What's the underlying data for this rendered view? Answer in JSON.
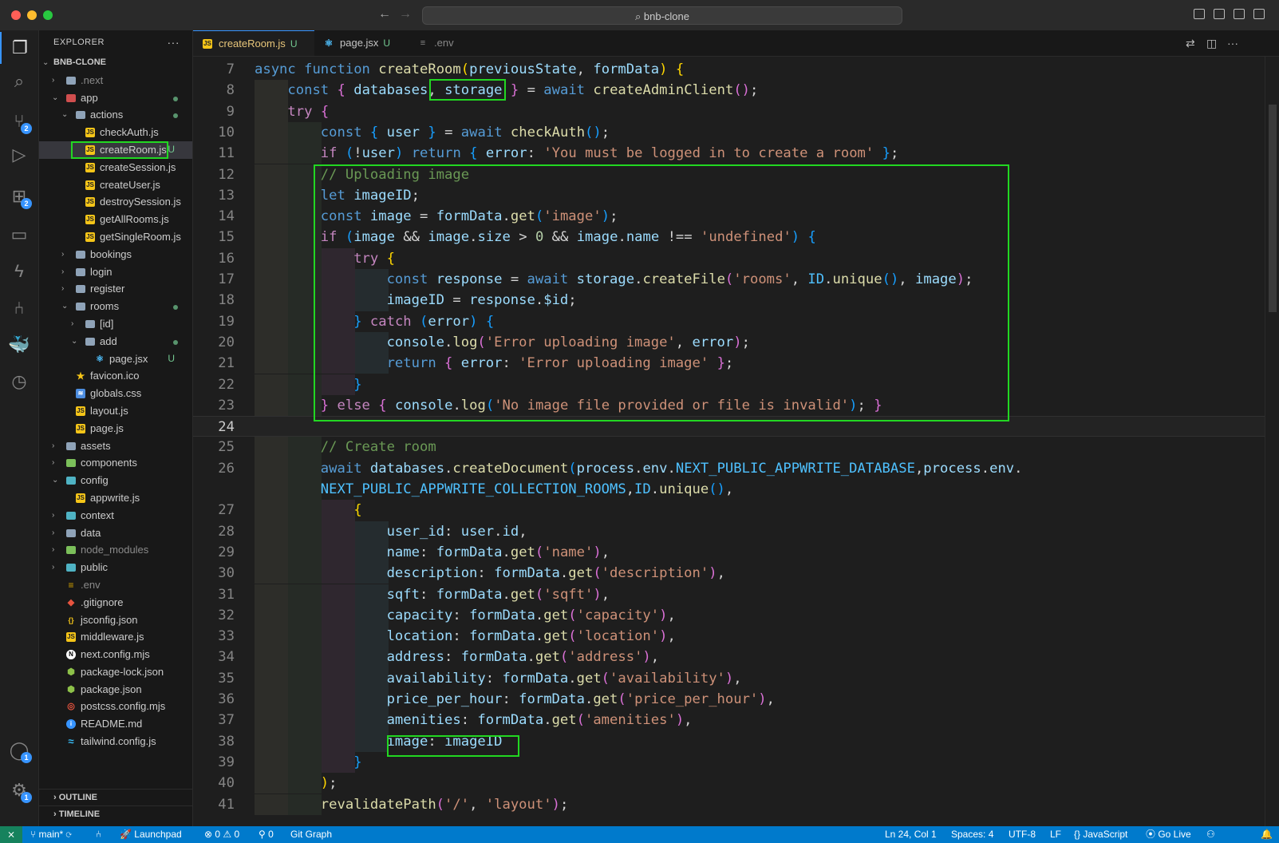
{
  "window": {
    "search_text": "bnb-clone",
    "back_glyph": "←",
    "forward_glyph": "→",
    "search_glyph": "⌕"
  },
  "activity_bar": {
    "items": [
      {
        "icon": "files-icon",
        "glyph": "❐",
        "active": true
      },
      {
        "icon": "search-icon",
        "glyph": "⌕"
      },
      {
        "icon": "source-control-icon",
        "glyph": "⑂",
        "badge": "2"
      },
      {
        "icon": "run-debug-icon",
        "glyph": "▷"
      },
      {
        "icon": "extensions-icon",
        "glyph": "⊞",
        "badge": "2"
      },
      {
        "icon": "remote-explorer-icon",
        "glyph": "▭"
      },
      {
        "icon": "thunder-client-icon",
        "glyph": "ϟ"
      },
      {
        "icon": "git-graph-icon",
        "glyph": "⑃"
      },
      {
        "icon": "docker-icon",
        "glyph": "🐳"
      },
      {
        "icon": "timeline-icon",
        "glyph": "◷"
      }
    ],
    "bottom": [
      {
        "icon": "account-icon",
        "glyph": "◯",
        "badge": "1"
      },
      {
        "icon": "manage-gear-icon",
        "glyph": "⚙",
        "badge": "1"
      }
    ]
  },
  "sidebar": {
    "title": "EXPLORER",
    "more_glyph": "···",
    "outline_label": "OUTLINE",
    "timeline_label": "TIMELINE",
    "tree": [
      {
        "label": "BNB-CLONE",
        "depth": 0,
        "type": "root",
        "open": true
      },
      {
        "label": ".next",
        "depth": 1,
        "type": "folder",
        "open": false,
        "color": "gray",
        "dim": true
      },
      {
        "label": "app",
        "depth": 1,
        "type": "folder",
        "open": true,
        "color": "red",
        "git": "dot",
        "git_color": "#73c991"
      },
      {
        "label": "actions",
        "depth": 2,
        "type": "folder",
        "open": true,
        "color": "gray",
        "git": "dot",
        "git_color": "#73c991"
      },
      {
        "label": "checkAuth.js",
        "depth": 3,
        "type": "js"
      },
      {
        "label": "createRoom.js",
        "depth": 3,
        "type": "js",
        "git": "U",
        "git_color": "#73c991",
        "selected": true
      },
      {
        "label": "createSession.js",
        "depth": 3,
        "type": "js"
      },
      {
        "label": "createUser.js",
        "depth": 3,
        "type": "js"
      },
      {
        "label": "destroySession.js",
        "depth": 3,
        "type": "js"
      },
      {
        "label": "getAllRooms.js",
        "depth": 3,
        "type": "js"
      },
      {
        "label": "getSingleRoom.js",
        "depth": 3,
        "type": "js"
      },
      {
        "label": "bookings",
        "depth": 2,
        "type": "folder",
        "open": false,
        "color": "gray"
      },
      {
        "label": "login",
        "depth": 2,
        "type": "folder",
        "open": false,
        "color": "gray"
      },
      {
        "label": "register",
        "depth": 2,
        "type": "folder",
        "open": false,
        "color": "gray"
      },
      {
        "label": "rooms",
        "depth": 2,
        "type": "folder",
        "open": true,
        "color": "gray",
        "git": "dot",
        "git_color": "#73c991"
      },
      {
        "label": "[id]",
        "depth": 3,
        "type": "folder",
        "open": false,
        "color": "gray"
      },
      {
        "label": "add",
        "depth": 3,
        "type": "folder",
        "open": true,
        "color": "gray",
        "git": "dot",
        "git_color": "#73c991"
      },
      {
        "label": "page.jsx",
        "depth": 4,
        "type": "react",
        "git": "U",
        "git_color": "#73c991"
      },
      {
        "label": "favicon.ico",
        "depth": 2,
        "type": "star"
      },
      {
        "label": "globals.css",
        "depth": 2,
        "type": "css"
      },
      {
        "label": "layout.js",
        "depth": 2,
        "type": "js"
      },
      {
        "label": "page.js",
        "depth": 2,
        "type": "js"
      },
      {
        "label": "assets",
        "depth": 1,
        "type": "folder",
        "open": false,
        "color": "gray"
      },
      {
        "label": "components",
        "depth": 1,
        "type": "folder",
        "open": false,
        "color": "green"
      },
      {
        "label": "config",
        "depth": 1,
        "type": "folder",
        "open": true,
        "color": "teal"
      },
      {
        "label": "appwrite.js",
        "depth": 2,
        "type": "js"
      },
      {
        "label": "context",
        "depth": 1,
        "type": "folder",
        "open": false,
        "color": "teal"
      },
      {
        "label": "data",
        "depth": 1,
        "type": "folder",
        "open": false,
        "color": "gray"
      },
      {
        "label": "node_modules",
        "depth": 1,
        "type": "folder",
        "open": false,
        "color": "green",
        "dim": true
      },
      {
        "label": "public",
        "depth": 1,
        "type": "folder",
        "open": false,
        "color": "teal"
      },
      {
        "label": ".env",
        "depth": 1,
        "type": "env",
        "dim": true
      },
      {
        "label": ".gitignore",
        "depth": 1,
        "type": "git"
      },
      {
        "label": "jsconfig.json",
        "depth": 1,
        "type": "json"
      },
      {
        "label": "middleware.js",
        "depth": 1,
        "type": "js"
      },
      {
        "label": "next.config.mjs",
        "depth": 1,
        "type": "next"
      },
      {
        "label": "package-lock.json",
        "depth": 1,
        "type": "npm"
      },
      {
        "label": "package.json",
        "depth": 1,
        "type": "npm"
      },
      {
        "label": "postcss.config.mjs",
        "depth": 1,
        "type": "postcss"
      },
      {
        "label": "README.md",
        "depth": 1,
        "type": "info"
      },
      {
        "label": "tailwind.config.js",
        "depth": 1,
        "type": "tailwind"
      }
    ]
  },
  "tabs": [
    {
      "label": "createRoom.js",
      "icon_text": "JS",
      "status": "U",
      "active": true
    },
    {
      "label": "page.jsx",
      "icon_text": "⚛",
      "status": "U",
      "active": false
    },
    {
      "label": ".env",
      "icon_text": "≡",
      "status": "",
      "active": false
    }
  ],
  "tab_actions": [
    {
      "icon": "compare-icon",
      "glyph": "⇄"
    },
    {
      "icon": "split-editor-icon",
      "glyph": "◫"
    },
    {
      "icon": "more-actions-icon",
      "glyph": "···"
    }
  ],
  "editor": {
    "first_line_number": "7",
    "lines": [
      {
        "n": "7",
        "text": "async function createRoom(previousState, formData) {"
      },
      {
        "n": "8",
        "text": "    const { databases, storage } = await createAdminClient();"
      },
      {
        "n": "9",
        "text": "    try {"
      },
      {
        "n": "10",
        "text": "        const { user } = await checkAuth();"
      },
      {
        "n": "11",
        "text": "        if (!user) return { error: 'You must be logged in to create a room' };"
      },
      {
        "n": "12",
        "text": "        // Uploading image"
      },
      {
        "n": "13",
        "text": "        let imageID;"
      },
      {
        "n": "14",
        "text": "        const image = formData.get('image');"
      },
      {
        "n": "15",
        "text": "        if (image && image.size > 0 && image.name !== 'undefined') {"
      },
      {
        "n": "16",
        "text": "            try {"
      },
      {
        "n": "17",
        "text": "                const response = await storage.createFile('rooms', ID.unique(), image);"
      },
      {
        "n": "18",
        "text": "                imageID = response.$id;"
      },
      {
        "n": "19",
        "text": "            } catch (error) {"
      },
      {
        "n": "20",
        "text": "                console.log('Error uploading image', error);"
      },
      {
        "n": "21",
        "text": "                return { error: 'Error uploading image' };"
      },
      {
        "n": "22",
        "text": "            }"
      },
      {
        "n": "23",
        "text": "        } else { console.log('No image file provided or file is invalid'); }"
      },
      {
        "n": "24",
        "text": "",
        "cursor": true
      },
      {
        "n": "25",
        "text": "        // Create room"
      },
      {
        "n": "26",
        "text": "        await databases.createDocument(process.env.NEXT_PUBLIC_APPWRITE_DATABASE,process.env."
      },
      {
        "n": "",
        "text": "        NEXT_PUBLIC_APPWRITE_COLLECTION_ROOMS,ID.unique(),"
      },
      {
        "n": "27",
        "text": "            {"
      },
      {
        "n": "28",
        "text": "                user_id: user.id,"
      },
      {
        "n": "29",
        "text": "                name: formData.get('name'),"
      },
      {
        "n": "30",
        "text": "                description: formData.get('description'),"
      },
      {
        "n": "31",
        "text": "                sqft: formData.get('sqft'),"
      },
      {
        "n": "32",
        "text": "                capacity: formData.get('capacity'),"
      },
      {
        "n": "33",
        "text": "                location: formData.get('location'),"
      },
      {
        "n": "34",
        "text": "                address: formData.get('address'),"
      },
      {
        "n": "35",
        "text": "                availability: formData.get('availability'),"
      },
      {
        "n": "36",
        "text": "                price_per_hour: formData.get('price_per_hour'),"
      },
      {
        "n": "37",
        "text": "                amenities: formData.get('amenities'),"
      },
      {
        "n": "38",
        "text": "                image: imageID"
      },
      {
        "n": "39",
        "text": "            }"
      },
      {
        "n": "40",
        "text": "        );"
      },
      {
        "n": "41",
        "text": "        revalidatePath('/', 'layout');"
      }
    ]
  },
  "statusbar": {
    "remote_glyph": "⨯",
    "branch": "main*",
    "sync_glyph": "⟳",
    "launchpad": "Launchpad",
    "problems": "⊗ 0 ⚠ 0",
    "ports": "⚲ 0",
    "git_graph": "Git Graph",
    "cursor_pos": "Ln 24, Col 1",
    "spaces": "Spaces: 4",
    "encoding": "UTF-8",
    "eol": "LF",
    "language": "JavaScript",
    "go_live": "Go Live",
    "bell_glyph": "🔔"
  }
}
